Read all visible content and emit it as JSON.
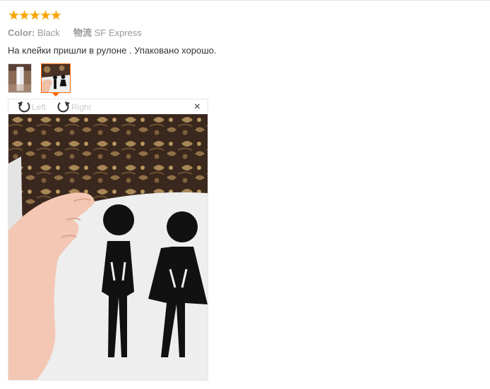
{
  "review": {
    "rating": 5,
    "stars": [
      "★",
      "★",
      "★",
      "★",
      "★"
    ],
    "color_label": "Color:",
    "color_value": "Black",
    "logistics_label": "物流",
    "logistics_value": "SF Express",
    "text": "На клейки пришли в рулоне . Упаковано хорошо."
  },
  "viewer": {
    "rotate_left_label": "Left",
    "rotate_right_label": "Right",
    "close_icon": "×"
  },
  "colors": {
    "star": "#f7a400",
    "active_thumb_border": "#ff6600",
    "muted_text": "#999999"
  },
  "icons": {
    "rotate_left": "rotate-left-icon",
    "rotate_right": "rotate-right-icon",
    "close": "close-icon"
  }
}
